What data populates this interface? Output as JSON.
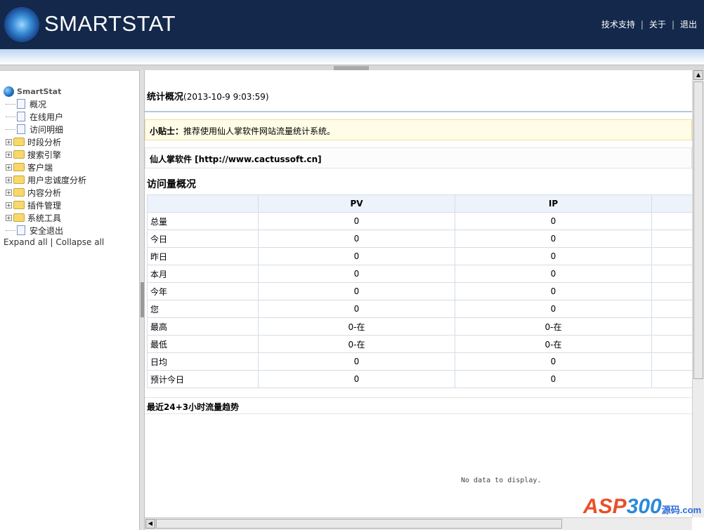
{
  "header": {
    "logo": "SMARTSTAT",
    "links": [
      "技术支持",
      "关于",
      "退出"
    ],
    "separator": "|"
  },
  "sidebar": {
    "root": "SmartStat",
    "items": [
      {
        "label": "概况",
        "type": "doc"
      },
      {
        "label": "在线用户",
        "type": "doc"
      },
      {
        "label": "访问明细",
        "type": "doc"
      },
      {
        "label": "时段分析",
        "type": "folder"
      },
      {
        "label": "搜索引擎",
        "type": "folder"
      },
      {
        "label": "客户端",
        "type": "folder"
      },
      {
        "label": "用户忠诚度分析",
        "type": "folder"
      },
      {
        "label": "内容分析",
        "type": "folder"
      },
      {
        "label": "插件管理",
        "type": "folder"
      },
      {
        "label": "系统工具",
        "type": "folder"
      },
      {
        "label": "安全退出",
        "type": "doc"
      }
    ],
    "expand_all": "Expand all",
    "divider": "|",
    "collapse_all": "Collapse all"
  },
  "main": {
    "title": "统计概况",
    "timestamp": "(2013-10-9 9:03:59)",
    "tip_label": "小贴士：",
    "tip_text": "推荐使用仙人掌软件网站流量统计系统。",
    "company": "仙人掌软件 [http://www.cactussoft.cn]",
    "visits_title": "访问量概况",
    "table": {
      "headers": [
        "",
        "PV",
        "IP"
      ],
      "rows": [
        [
          "总量",
          "0",
          "0"
        ],
        [
          "今日",
          "0",
          "0"
        ],
        [
          "昨日",
          "0",
          "0"
        ],
        [
          "本月",
          "0",
          "0"
        ],
        [
          "今年",
          "0",
          "0"
        ],
        [
          "您",
          "0",
          "0"
        ],
        [
          "最高",
          "0-在",
          "0-在"
        ],
        [
          "最低",
          "0-在",
          "0-在"
        ],
        [
          "日均",
          "0",
          "0"
        ],
        [
          "预计今日",
          "0",
          "0"
        ]
      ]
    },
    "trend_title": "最近24+3小时流量趋势",
    "no_data": "No data to display."
  },
  "watermark": "ASP300源码.com"
}
